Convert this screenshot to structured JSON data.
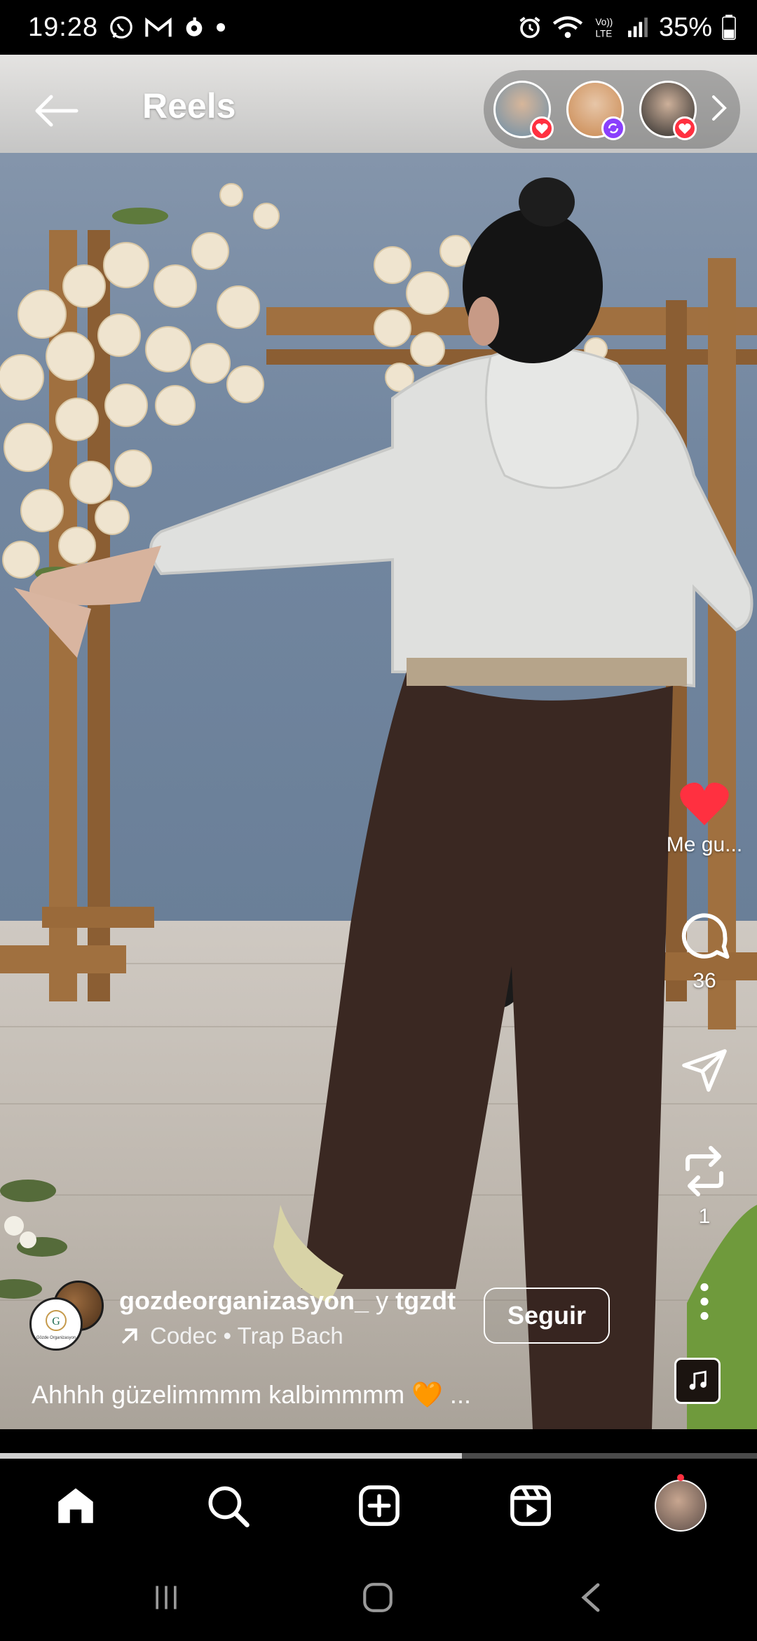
{
  "status_bar": {
    "time": "19:28",
    "battery": "35%",
    "network_label": "VoLTE"
  },
  "header": {
    "title": "Reels"
  },
  "stories": [
    {
      "name": "story-1",
      "badge": "heart",
      "badge_color": "#ff3040"
    },
    {
      "name": "story-2",
      "badge": "sync",
      "badge_color": "#8a3ffc"
    },
    {
      "name": "story-3",
      "badge": "heart",
      "badge_color": "#ff3040"
    }
  ],
  "actions": {
    "like_label": "Me gu...",
    "comments_count": "36",
    "reposts_count": "1"
  },
  "post": {
    "author": "gozdeorganizasyon_",
    "conjunction": "y",
    "coauthor": "tgzdt",
    "audio": "Codec • Trap Bach",
    "caption": "Ahhhh güzelimmmm kalbimmmm 🧡 ...",
    "follow_label": "Seguir",
    "avatar_text": "Gözde Organizasyon"
  },
  "playback": {
    "progress_fraction": 0.61
  },
  "colors": {
    "like_red": "#ff3040",
    "accent_purple": "#8a3ffc"
  },
  "nav": {
    "items": [
      "home-icon",
      "search-icon",
      "create-icon",
      "reels-icon",
      "profile-avatar"
    ]
  }
}
